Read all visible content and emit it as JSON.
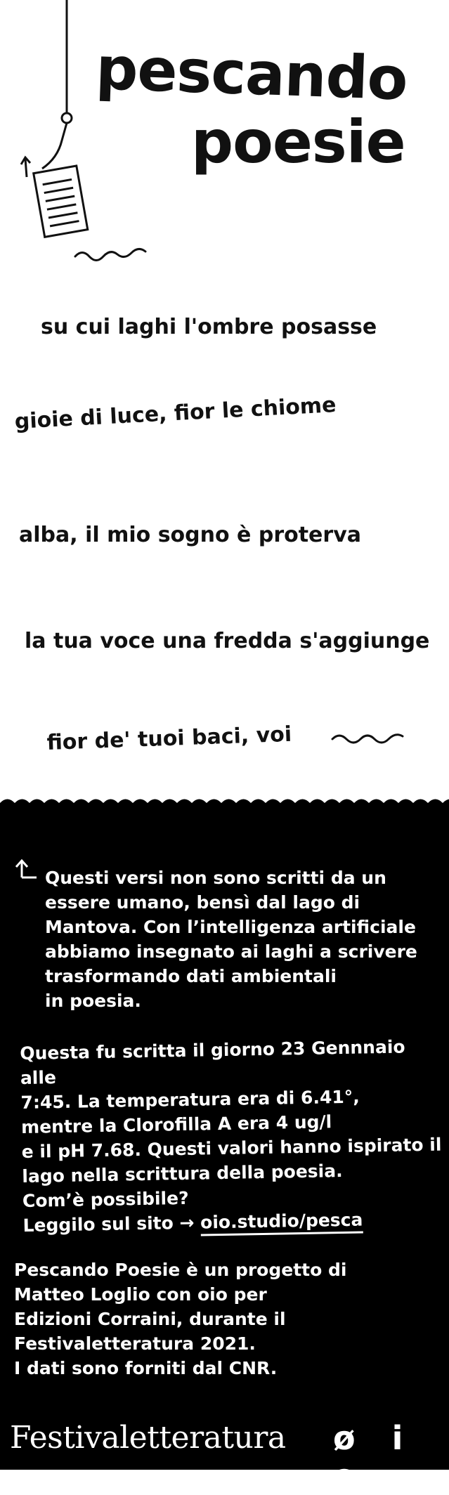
{
  "header": {
    "title_line1": "pescando",
    "title_line2": "poesie"
  },
  "poem": {
    "lines": [
      "su cui laghi l'ombre posasse",
      "gioie di luce, fior le chiome",
      "alba, il mio sogno è proterva",
      "la tua voce una fredda s'aggiunge",
      "fior de' tuoi baci, voi"
    ]
  },
  "info": {
    "intro_lines": [
      "Questi versi non sono scritti da un",
      "essere umano, bensì dal lago di",
      "Mantova. Con l’intelligenza artificiale",
      "abbiamo insegnato ai laghi a scrivere",
      "trasformando dati ambientali",
      "in poesia."
    ],
    "data_lines": [
      "Questa fu scritta il giorno 23 Gennnaio alle",
      "7:45. La temperatura era di 6.41°,",
      "mentre la Clorofilla A era 4 ug/l",
      "e il pH 7.68. Questi valori hanno ispirato il",
      "lago nella scrittura della poesia.",
      "Com’è possibile?"
    ],
    "read_prefix": "Leggilo sul sito →",
    "read_link": "oio.studio/pesca",
    "credits_lines": [
      "Pescando Poesie è un progetto di",
      "Matteo Loglio con oio per",
      "Edizioni Corraini, durante il",
      "Festivaletteratura 2021.",
      "I dati sono forniti dal CNR."
    ]
  },
  "footer": {
    "festival_logo": "Festivaletteratura",
    "oio_logo": "ø i o"
  }
}
